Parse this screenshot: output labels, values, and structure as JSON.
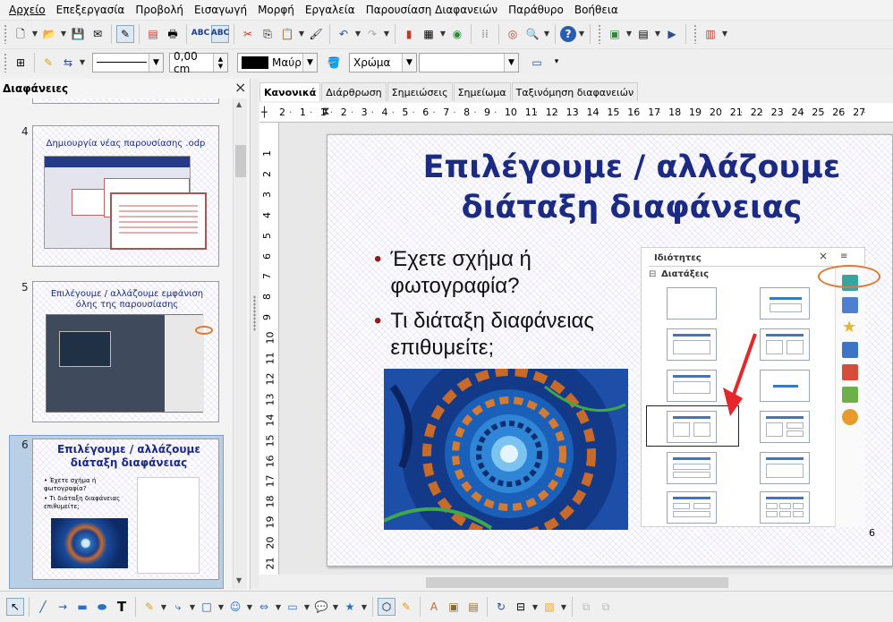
{
  "menu": [
    "Αρχείο",
    "Επεξεργασία",
    "Προβολή",
    "Εισαγωγή",
    "Μορφή",
    "Εργαλεία",
    "Παρουσίαση Διαφανειών",
    "Παράθυρο",
    "Βοήθεια"
  ],
  "line_toolbar": {
    "width_value": "0,00 cm",
    "color_label": "Μαύρ",
    "fill_type": "Χρώμα",
    "fill_value": ""
  },
  "slide_pane": {
    "title": "Διαφάνειες",
    "close": "×",
    "thumbs": [
      {
        "num": "4",
        "title": "Δημιουργία νέας παρουσίασης .odp"
      },
      {
        "num": "5",
        "title": "Επιλέγουμε / αλλάζουμε εμφάνιση όλης της παρουσίασης"
      },
      {
        "num": "6",
        "title": "Επιλέγουμε / αλλάζουμε διάταξη διαφάνειας",
        "bullets": [
          "Έχετε σχήμα ή φωτογραφία?",
          "Τι διάταξη διαφάνειας επιθυμείτε;"
        ]
      }
    ]
  },
  "view_tabs": [
    "Κανονικά",
    "Διάρθρωση",
    "Σημειώσεις",
    "Σημείωμα",
    "Ταξινόμηση διαφανειών"
  ],
  "ruler_h": [
    "2",
    "1",
    "1",
    "2",
    "3",
    "4",
    "5",
    "6",
    "7",
    "8",
    "9",
    "10",
    "11",
    "12",
    "13",
    "14",
    "15",
    "16",
    "17",
    "18",
    "19",
    "20",
    "21",
    "22",
    "23",
    "24",
    "25",
    "26",
    "27"
  ],
  "ruler_v": [
    "1",
    "2",
    "3",
    "4",
    "5",
    "6",
    "7",
    "8",
    "9",
    "10",
    "11",
    "12",
    "13",
    "14",
    "15",
    "16",
    "17",
    "18",
    "19",
    "20",
    "21"
  ],
  "slide": {
    "title_line1": "Επιλέγουμε / αλλάζουμε",
    "title_line2": "διάταξη διαφάνειας",
    "bullet1": "Έχετε σχήμα ή φωτογραφία?",
    "bullet2": "Τι διάταξη διαφάνειας επιθυμείτε;",
    "page_number": "6",
    "properties_title": "Ιδιότητες",
    "layouts_label": "Διατάξεις"
  },
  "colors": {
    "title": "#1b2a82",
    "bullet": "#8b1d1d",
    "highlight": "#e07a2e",
    "arrow": "#e5262a"
  }
}
